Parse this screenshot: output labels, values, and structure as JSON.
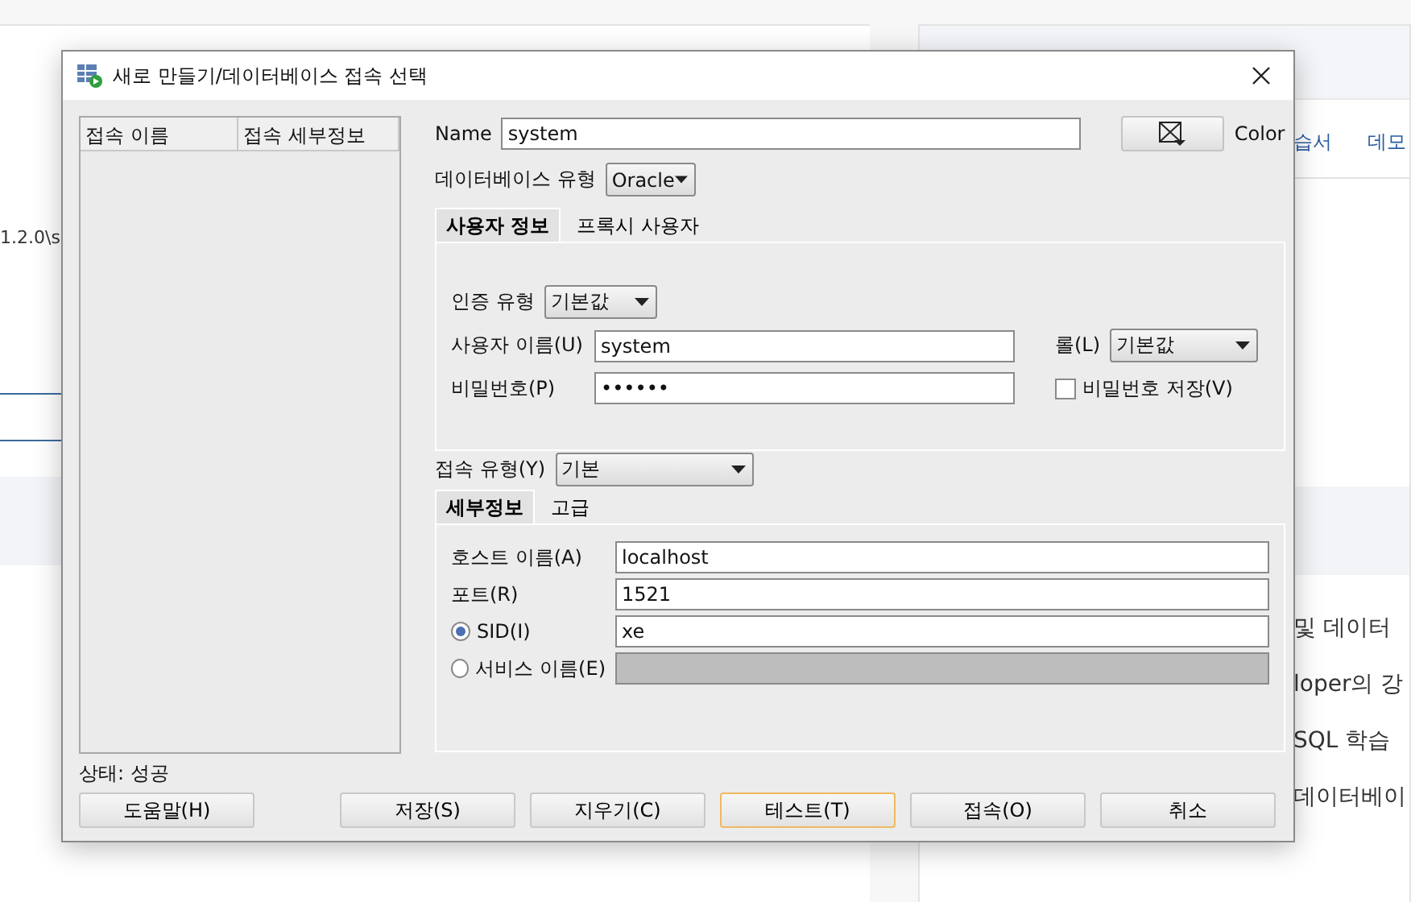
{
  "background": {
    "fragment": "1.2.0\\s",
    "tabs": [
      "습서",
      "데모"
    ],
    "lines": [
      "및 데이터",
      "loper의 강",
      "SQL 학습",
      "데이터베이"
    ]
  },
  "dialog": {
    "title": "새로 만들기/데이터베이스 접속 선택",
    "connections_table": {
      "columns": [
        "접속 이름",
        "접속 세부정보"
      ]
    },
    "status": "상태: 성공",
    "form": {
      "name_label": "Name",
      "name_value": "system",
      "color_label": "Color",
      "db_type_label": "데이터베이스 유형",
      "db_type_value": "Oracle",
      "user_tabs": [
        {
          "label": "사용자 정보",
          "selected": true
        },
        {
          "label": "프록시 사용자",
          "selected": false
        }
      ],
      "auth_type_label": "인증 유형",
      "auth_type_value": "기본값",
      "username_label": "사용자 이름(U)",
      "username_value": "system",
      "role_label": "롤(L)",
      "role_value": "기본값",
      "password_label": "비밀번호(P)",
      "password_value": "••••••",
      "save_password": {
        "label": "비밀번호 저장(V)",
        "checked": false
      },
      "conn_type_label": "접속 유형(Y)",
      "conn_type_value": "기본",
      "detail_tabs": [
        {
          "label": "세부정보",
          "selected": true
        },
        {
          "label": "고급",
          "selected": false
        }
      ],
      "host_label": "호스트 이름(A)",
      "host_value": "localhost",
      "port_label": "포트(R)",
      "port_value": "1521",
      "sid_options": [
        {
          "label": "SID(I)",
          "selected": true,
          "disabled": false,
          "value": "xe"
        },
        {
          "label": "서비스 이름(E)",
          "selected": false,
          "disabled": true
        }
      ]
    },
    "buttons": [
      {
        "label": "도움말(H)",
        "focused": false
      },
      {
        "label": "저장(S)",
        "focused": false
      },
      {
        "label": "지우기(C)",
        "focused": false
      },
      {
        "label": "테스트(T)",
        "focused": true
      },
      {
        "label": "접속(O)",
        "focused": false
      },
      {
        "label": "취소",
        "focused": false
      }
    ]
  }
}
